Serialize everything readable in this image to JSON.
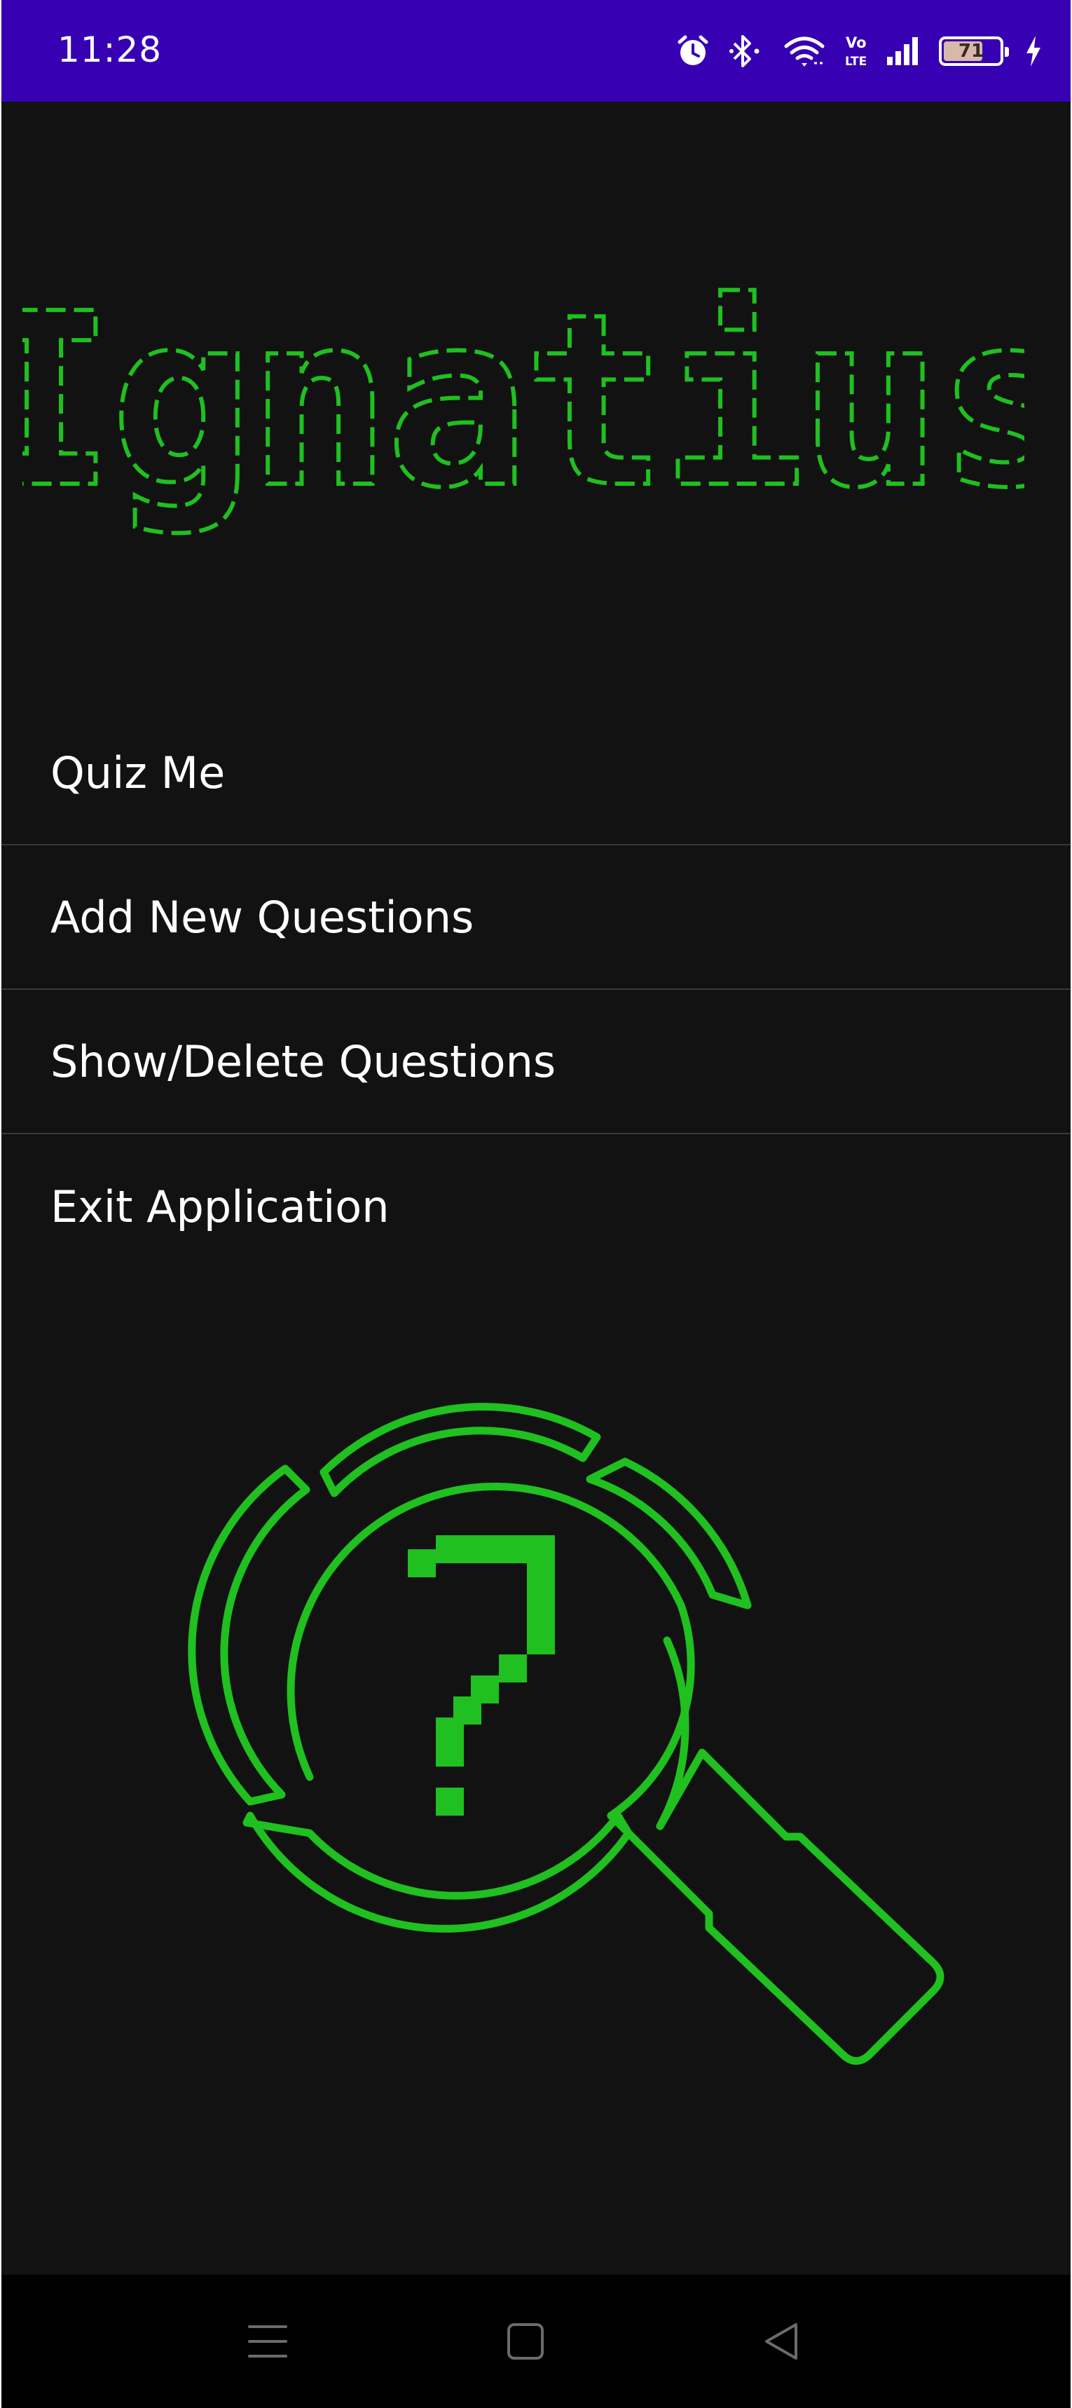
{
  "status_bar": {
    "time": "11:28",
    "battery_level": "71",
    "icons": [
      "alarm-icon",
      "bluetooth-icon",
      "wifi-icon",
      "volte-icon",
      "signal-icon",
      "battery-icon",
      "charging-icon"
    ]
  },
  "app": {
    "logo_text": "Ignatius",
    "accent_color": "#1fc01f",
    "background_color": "#121212",
    "status_bar_color": "#3700b3"
  },
  "menu": {
    "items": [
      {
        "label": "Quiz Me"
      },
      {
        "label": "Add New Questions"
      },
      {
        "label": "Show/Delete Questions"
      },
      {
        "label": "Exit Application"
      }
    ]
  },
  "illustration": {
    "icon": "magnifier-question-icon"
  },
  "nav_bar": {
    "buttons": [
      "recents-icon",
      "home-icon",
      "back-icon"
    ]
  }
}
